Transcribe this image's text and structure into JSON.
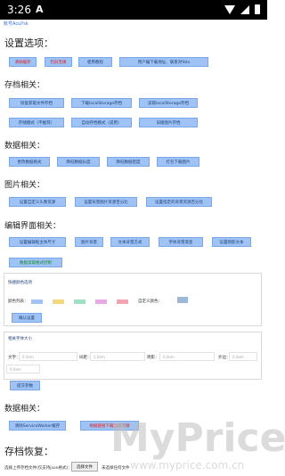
{
  "status": {
    "time": "3:26",
    "notif": "A"
  },
  "app": {
    "title": "账号AcuYsk"
  },
  "settings": {
    "heading": "设置选项：",
    "buttons": [
      "清除缓存",
      "仍旧无缘",
      "使用教程",
      "用户编下载地址、联系对Yolo"
    ]
  },
  "storage": {
    "heading": "存档相关：",
    "buttons": [
      "恢复获取文件存档",
      "下载localStorage存档",
      "读取localStorage存档",
      "存储模式（不推荐）",
      "自动存档模式（适用）",
      "旧版图片存档"
    ]
  },
  "data": {
    "heading": "数据相关：",
    "buttons": [
      "更改数据格式",
      "降低数据长度",
      "降低数据密度",
      "打包下载图片"
    ]
  },
  "image": {
    "heading": "图片相关：",
    "buttons": [
      "设置自定义头像资源",
      "设置背景图片资源百分比",
      "设置指定的背景资源百分比"
    ]
  },
  "editor": {
    "heading": "编辑界面相关：",
    "buttons": [
      "设置编辑框主体尺寸",
      "图片背景",
      "文本背景方式",
      "字体背景渐变",
      "设置阴影文本",
      "数据读取格式控制"
    ]
  },
  "colors": {
    "heading": "快捷颜色选项",
    "label": "颜色列表：",
    "custom_label": "自定义颜色：",
    "apply": "确认设置",
    "swatches": [
      "#9ec3f4",
      "#f4d77a",
      "#9ee0c4",
      "#e7a8e6",
      "#f4a3b0"
    ],
    "custom_swatch": "#9bb8d8"
  },
  "fontsize": {
    "heading": "相关字体大小",
    "labels": [
      "文字：",
      "间距：",
      "阴影：",
      "外边："
    ],
    "placeholders": [
      "0.0em",
      "1.0em",
      "0.0em",
      "0.0em",
      "0.0em"
    ],
    "apply": "提交参数"
  },
  "data2": {
    "heading": "数据相关：",
    "buttons": [
      "清除ServiceWorker缓存",
      "根据链接下载当前资源"
    ]
  },
  "restore": {
    "heading": "存档恢复：",
    "label": "选择上传存档文件(仅支持json格式)：",
    "file_btn": "选择文件",
    "file_status": "未选择任何文件"
  },
  "watermark": {
    "big": "MyPrice",
    "url": "www.myprice.com.cn"
  }
}
